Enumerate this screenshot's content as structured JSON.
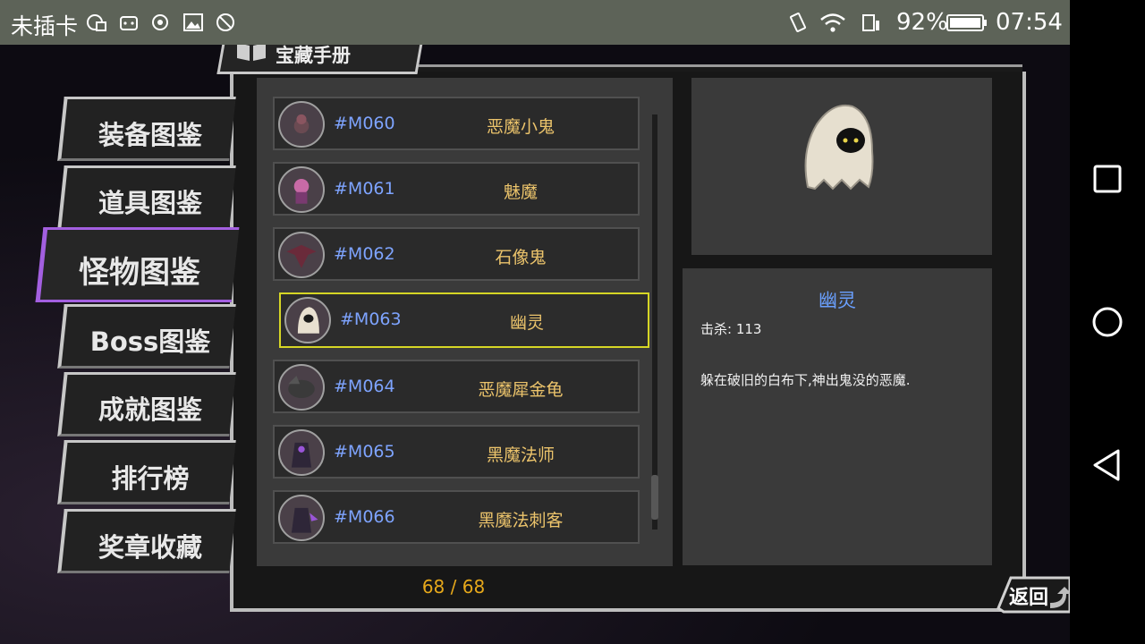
{
  "status_bar": {
    "carrier": "未插卡",
    "battery": "92%",
    "time": "07:54",
    "icons": [
      "sim-card-icon",
      "game-controller-icon",
      "camera-ring-icon",
      "image-icon",
      "no-disturb-icon",
      "vibrate-icon",
      "wifi-icon",
      "sim-signal-icon",
      "battery-icon"
    ]
  },
  "title": "宝藏手册",
  "sidebar": {
    "items": [
      {
        "label": "装备图鉴"
      },
      {
        "label": "道具图鉴"
      },
      {
        "label": "怪物图鉴"
      },
      {
        "label": "Boss图鉴"
      },
      {
        "label": "成就图鉴"
      },
      {
        "label": "排行榜"
      },
      {
        "label": "奖章收藏"
      }
    ],
    "active_index": 2,
    "active_color": "#a35fe0"
  },
  "monster_list": [
    {
      "code": "#M060",
      "name": "恶魔小鬼"
    },
    {
      "code": "#M061",
      "name": "魅魔"
    },
    {
      "code": "#M062",
      "name": "石像鬼"
    },
    {
      "code": "#M063",
      "name": "幽灵"
    },
    {
      "code": "#M064",
      "name": "恶魔犀金龟"
    },
    {
      "code": "#M065",
      "name": "黑魔法师"
    },
    {
      "code": "#M066",
      "name": "黑魔法刺客"
    }
  ],
  "selected_index": 3,
  "page_count": "68 / 68",
  "detail": {
    "name": "幽灵",
    "kills": "击杀: 113",
    "description": "躲在破旧的白布下,神出鬼没的恶魔."
  },
  "back_label": "返回",
  "colors": {
    "code": "#7ea4ff",
    "name": "#ebc36b",
    "selected_border": "#d6d625",
    "page_count": "#e6a81b",
    "detail_name": "#6aa0ff"
  }
}
